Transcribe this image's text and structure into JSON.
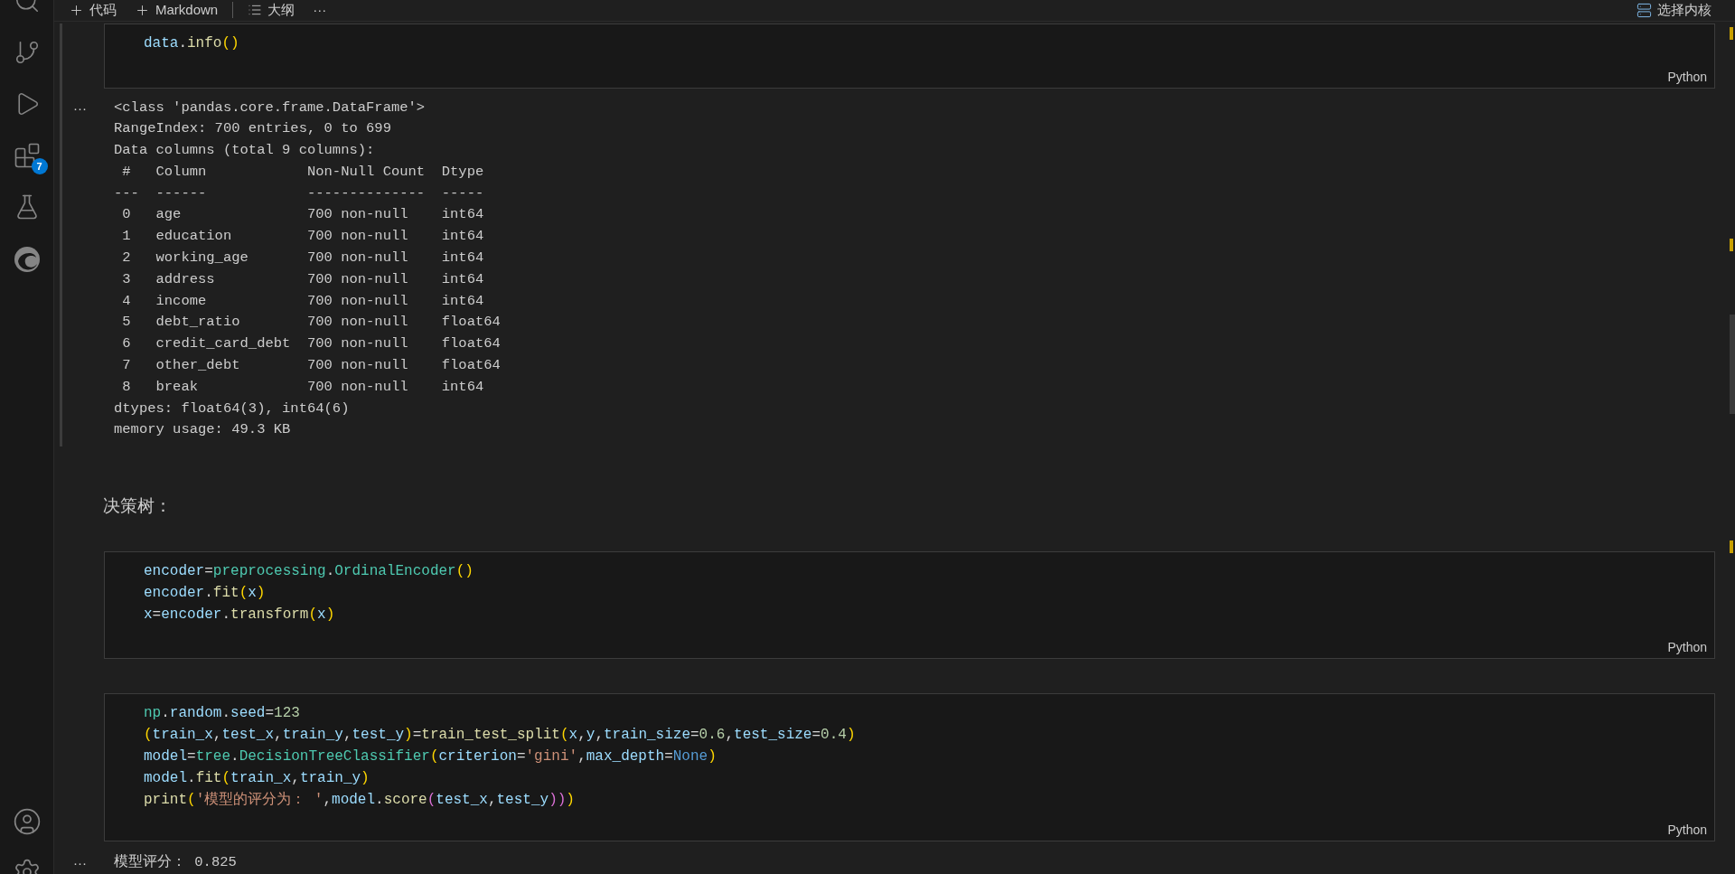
{
  "toolbar": {
    "items": [
      {
        "kind": "add",
        "label": "代码"
      },
      {
        "kind": "add",
        "label": "Markdown"
      },
      {
        "kind": "outline",
        "label": "大纲"
      },
      {
        "kind": "more",
        "label": "···"
      }
    ],
    "kernel": "选择内核"
  },
  "activity_bar": {
    "extensions_badge": "7"
  },
  "cells": [
    {
      "kind": "code",
      "language": "Python",
      "lines": [
        [
          {
            "text": "data",
            "kind": "var"
          },
          {
            "text": ".",
            "kind": "op"
          },
          {
            "text": "info",
            "kind": "fn"
          },
          {
            "text": "()",
            "kind": "br1"
          }
        ]
      ],
      "output": {
        "more": "···",
        "lines": [
          "<class 'pandas.core.frame.DataFrame'>",
          "RangeIndex: 700 entries, 0 to 699",
          "Data columns (total 9 columns):",
          " #   Column            Non-Null Count  Dtype  ",
          "---  ------            --------------  -----  ",
          " 0   age               700 non-null    int64  ",
          " 1   education         700 non-null    int64  ",
          " 2   working_age       700 non-null    int64  ",
          " 3   address           700 non-null    int64  ",
          " 4   income            700 non-null    int64  ",
          " 5   debt_ratio        700 non-null    float64",
          " 6   credit_card_debt  700 non-null    float64",
          " 7   other_debt        700 non-null    float64",
          " 8   break             700 non-null    int64  ",
          "dtypes: float64(3), int64(6)",
          "memory usage: 49.3 KB"
        ]
      }
    },
    {
      "kind": "markdown",
      "text": "决策树："
    },
    {
      "kind": "code",
      "language": "Python",
      "lines": [
        [
          {
            "text": "encoder",
            "kind": "var"
          },
          {
            "text": "=",
            "kind": "op"
          },
          {
            "text": "preprocessing",
            "kind": "cls"
          },
          {
            "text": ".",
            "kind": "op"
          },
          {
            "text": "OrdinalEncoder",
            "kind": "cls"
          },
          {
            "text": "()",
            "kind": "br1"
          }
        ],
        [
          {
            "text": "encoder",
            "kind": "var"
          },
          {
            "text": ".",
            "kind": "op"
          },
          {
            "text": "fit",
            "kind": "fn"
          },
          {
            "text": "(",
            "kind": "br1"
          },
          {
            "text": "x",
            "kind": "var"
          },
          {
            "text": ")",
            "kind": "br1"
          }
        ],
        [
          {
            "text": "x",
            "kind": "var"
          },
          {
            "text": "=",
            "kind": "op"
          },
          {
            "text": "encoder",
            "kind": "var"
          },
          {
            "text": ".",
            "kind": "op"
          },
          {
            "text": "transform",
            "kind": "fn"
          },
          {
            "text": "(",
            "kind": "br1"
          },
          {
            "text": "x",
            "kind": "var"
          },
          {
            "text": ")",
            "kind": "br1"
          }
        ]
      ]
    },
    {
      "kind": "code",
      "language": "Python",
      "lines": [
        [
          {
            "text": "np",
            "kind": "cls"
          },
          {
            "text": ".",
            "kind": "op"
          },
          {
            "text": "random",
            "kind": "var"
          },
          {
            "text": ".",
            "kind": "op"
          },
          {
            "text": "seed",
            "kind": "var"
          },
          {
            "text": "=",
            "kind": "op"
          },
          {
            "text": "123",
            "kind": "num"
          }
        ],
        [
          {
            "text": "(",
            "kind": "br1"
          },
          {
            "text": "train_x",
            "kind": "var"
          },
          {
            "text": ",",
            "kind": "op"
          },
          {
            "text": "test_x",
            "kind": "var"
          },
          {
            "text": ",",
            "kind": "op"
          },
          {
            "text": "train_y",
            "kind": "var"
          },
          {
            "text": ",",
            "kind": "op"
          },
          {
            "text": "test_y",
            "kind": "var"
          },
          {
            "text": ")",
            "kind": "br1"
          },
          {
            "text": "=",
            "kind": "op"
          },
          {
            "text": "train_test_split",
            "kind": "fn"
          },
          {
            "text": "(",
            "kind": "br1"
          },
          {
            "text": "x",
            "kind": "var"
          },
          {
            "text": ",",
            "kind": "op"
          },
          {
            "text": "y",
            "kind": "var"
          },
          {
            "text": ",",
            "kind": "op"
          },
          {
            "text": "train_size",
            "kind": "var"
          },
          {
            "text": "=",
            "kind": "op"
          },
          {
            "text": "0.6",
            "kind": "num"
          },
          {
            "text": ",",
            "kind": "op"
          },
          {
            "text": "test_size",
            "kind": "var"
          },
          {
            "text": "=",
            "kind": "op"
          },
          {
            "text": "0.4",
            "kind": "num"
          },
          {
            "text": ")",
            "kind": "br1"
          }
        ],
        [
          {
            "text": "model",
            "kind": "var"
          },
          {
            "text": "=",
            "kind": "op"
          },
          {
            "text": "tree",
            "kind": "cls"
          },
          {
            "text": ".",
            "kind": "op"
          },
          {
            "text": "DecisionTreeClassifier",
            "kind": "cls"
          },
          {
            "text": "(",
            "kind": "br1"
          },
          {
            "text": "criterion",
            "kind": "var"
          },
          {
            "text": "=",
            "kind": "op"
          },
          {
            "text": "'gini'",
            "kind": "str"
          },
          {
            "text": ",",
            "kind": "op"
          },
          {
            "text": "max_depth",
            "kind": "var"
          },
          {
            "text": "=",
            "kind": "op"
          },
          {
            "text": "None",
            "kind": "const"
          },
          {
            "text": ")",
            "kind": "br1"
          }
        ],
        [
          {
            "text": "model",
            "kind": "var"
          },
          {
            "text": ".",
            "kind": "op"
          },
          {
            "text": "fit",
            "kind": "fn"
          },
          {
            "text": "(",
            "kind": "br1"
          },
          {
            "text": "train_x",
            "kind": "var"
          },
          {
            "text": ",",
            "kind": "op"
          },
          {
            "text": "train_y",
            "kind": "var"
          },
          {
            "text": ")",
            "kind": "br1"
          }
        ],
        [
          {
            "text": "print",
            "kind": "fn"
          },
          {
            "text": "(",
            "kind": "br1"
          },
          {
            "text": "'模型的评分为： '",
            "kind": "str"
          },
          {
            "text": ",",
            "kind": "op"
          },
          {
            "text": "model",
            "kind": "var"
          },
          {
            "text": ".",
            "kind": "op"
          },
          {
            "text": "score",
            "kind": "fn"
          },
          {
            "text": "(",
            "kind": "br2"
          },
          {
            "text": "test_x",
            "kind": "var"
          },
          {
            "text": ",",
            "kind": "op"
          },
          {
            "text": "test_y",
            "kind": "var"
          },
          {
            "text": "))",
            "kind": "br2"
          },
          {
            "text": ")",
            "kind": "br1"
          }
        ]
      ],
      "output": {
        "more": "···",
        "lines": [
          "模型评分： 0.825"
        ]
      }
    }
  ]
}
